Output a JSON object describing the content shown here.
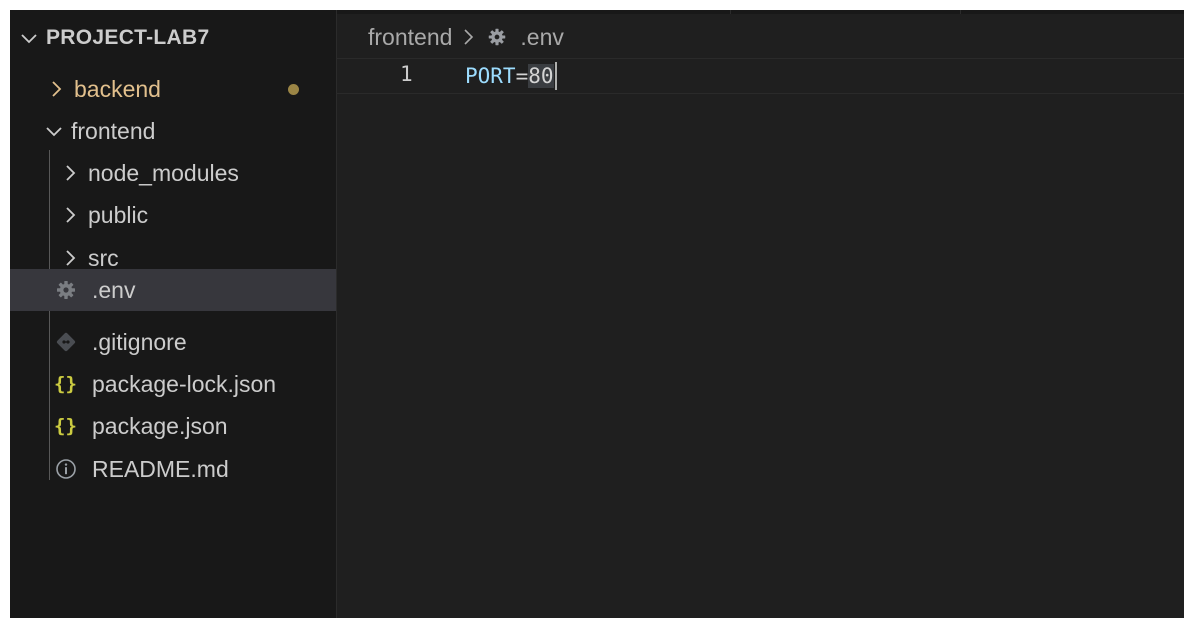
{
  "explorer": {
    "root_label": "PROJECT-LAB7",
    "items": [
      {
        "label": "backend",
        "type": "folder",
        "state": "collapsed",
        "modified": true
      },
      {
        "label": "frontend",
        "type": "folder",
        "state": "expanded"
      },
      {
        "label": "node_modules",
        "type": "folder",
        "state": "collapsed"
      },
      {
        "label": "public",
        "type": "folder",
        "state": "collapsed"
      },
      {
        "label": "src",
        "type": "folder",
        "state": "collapsed"
      },
      {
        "label": ".env",
        "type": "file",
        "icon": "gear-icon",
        "selected": true
      },
      {
        "label": ".gitignore",
        "type": "file",
        "icon": "git-icon"
      },
      {
        "label": "package-lock.json",
        "type": "file",
        "icon": "json-braces-icon",
        "icon_text": "{}"
      },
      {
        "label": "package.json",
        "type": "file",
        "icon": "json-braces-icon",
        "icon_text": "{}"
      },
      {
        "label": "README.md",
        "type": "file",
        "icon": "info-icon"
      }
    ]
  },
  "breadcrumb": {
    "folder": "frontend",
    "file": ".env"
  },
  "editor": {
    "line_number": "1",
    "key": "PORT",
    "equals": "=",
    "value": "80"
  },
  "colors": {
    "sidebar_bg": "#181818",
    "editor_bg": "#1f1f1f",
    "selection_bg": "#37373d",
    "modified_folder": "#e2c08d",
    "modified_dot": "#9b8545",
    "json_icon": "#cbcb41",
    "key_token": "#9cdcfe"
  }
}
